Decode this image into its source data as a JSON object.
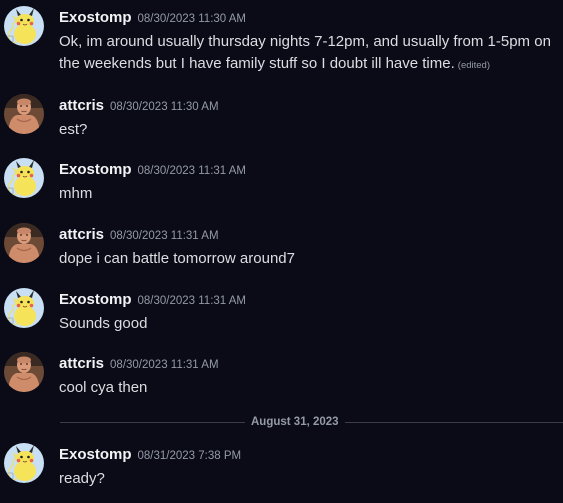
{
  "messages": [
    {
      "username": "Exostomp",
      "timestamp": "08/30/2023 11:30 AM",
      "text": "Ok, im around usually thursday nights 7-12pm, and usually from 1-5pm on the weekends but I have family stuff so I doubt ill have time.",
      "edited": "(edited)"
    },
    {
      "username": "attcris",
      "timestamp": "08/30/2023 11:30 AM",
      "text": "est?"
    },
    {
      "username": "Exostomp",
      "timestamp": "08/30/2023 11:31 AM",
      "text": "mhm"
    },
    {
      "username": "attcris",
      "timestamp": "08/30/2023 11:31 AM",
      "text": "dope i can battle tomorrow around7"
    },
    {
      "username": "Exostomp",
      "timestamp": "08/30/2023 11:31 AM",
      "text": "Sounds good"
    },
    {
      "username": "attcris",
      "timestamp": "08/30/2023 11:31 AM",
      "text": "cool cya then"
    },
    {
      "username": "Exostomp",
      "timestamp": "08/31/2023 7:38 PM",
      "text": "ready?"
    }
  ],
  "date_divider": "August 31, 2023",
  "avatars": {
    "exostomp": "pikachu-avatar-icon",
    "attcris": "user-photo-avatar-icon"
  },
  "colors": {
    "background": "#0b0b18",
    "username": "#f2f3f5",
    "text": "#dbdee1",
    "muted": "#949ba4",
    "divider": "#3b3d44"
  }
}
